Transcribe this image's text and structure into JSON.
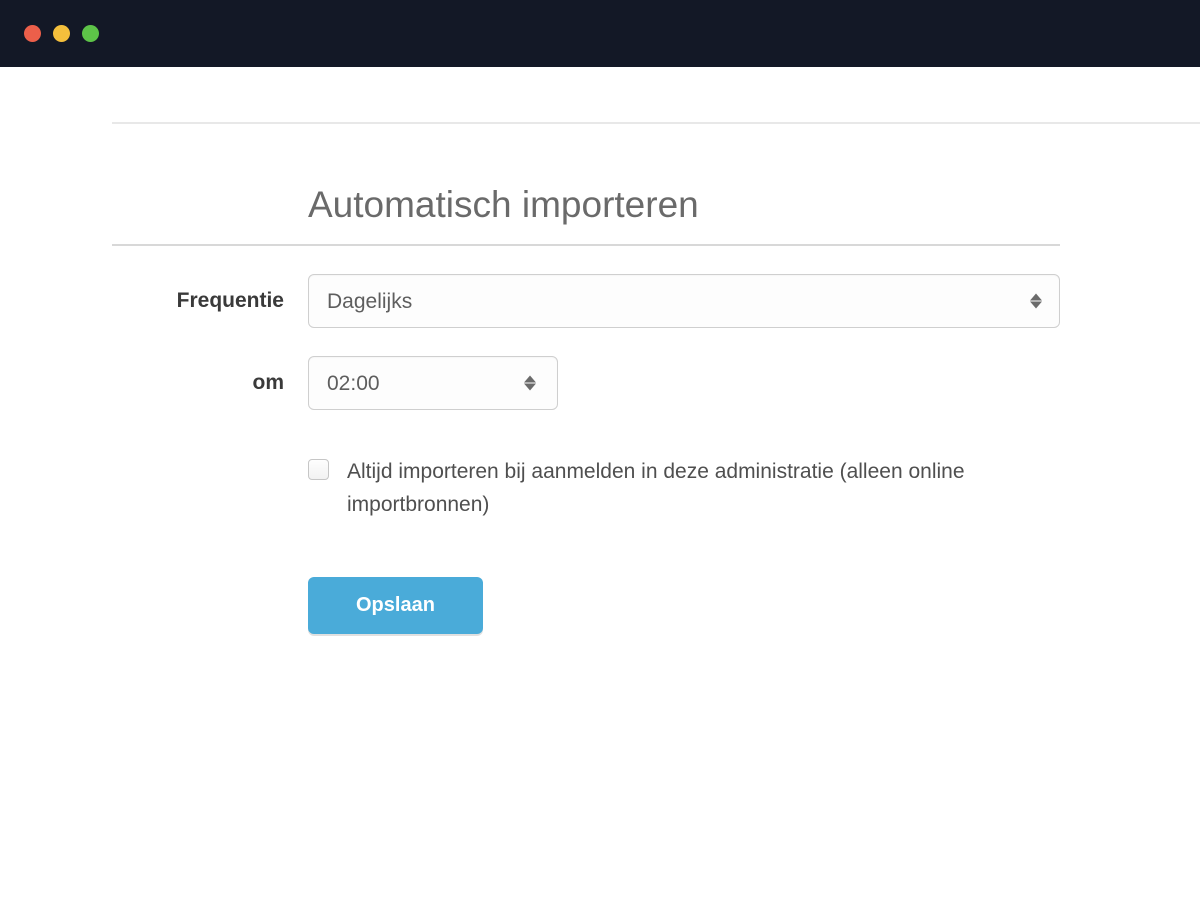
{
  "window": {
    "chrome": {
      "type": "mac-traffic-lights"
    }
  },
  "form": {
    "heading": "Automatisch importeren",
    "frequency": {
      "label": "Frequentie",
      "value": "Dagelijks"
    },
    "time": {
      "label": "om",
      "value": "02:00"
    },
    "always_import": {
      "checked": false,
      "label": "Altijd importeren bij aanmelden in deze administratie (alleen online importbronnen)"
    },
    "submit_label": "Opslaan"
  },
  "colors": {
    "primary_button": "#4aabd9",
    "heading_text": "#6a6a6a",
    "label_text": "#3a3a3a"
  }
}
